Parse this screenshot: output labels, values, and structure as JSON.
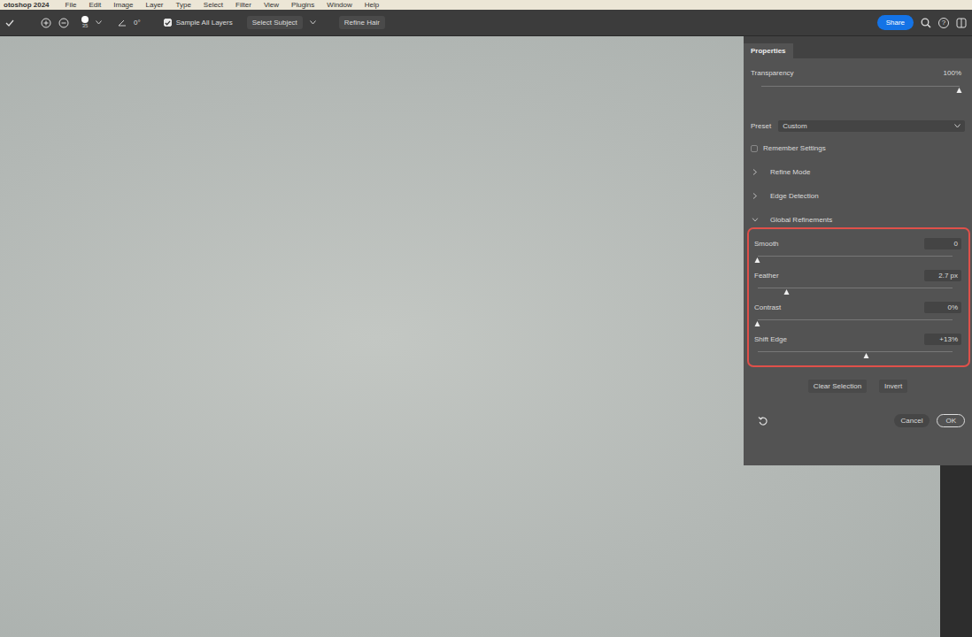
{
  "menu_bar": {
    "app": "otoshop 2024",
    "items": [
      "File",
      "Edit",
      "Image",
      "Layer",
      "Type",
      "Select",
      "Filter",
      "View",
      "Plugins",
      "Window",
      "Help"
    ]
  },
  "options_bar": {
    "brush_size": "35",
    "angle": "0°",
    "sample_all_layers": {
      "label": "Sample All Layers",
      "checked": true
    },
    "select_subject": "Select Subject",
    "refine_hair": "Refine Hair",
    "share": "Share",
    "help": "?"
  },
  "panel": {
    "tab": "Properties",
    "transparency": {
      "label": "Transparency",
      "reading": "100%",
      "level": 1
    },
    "preset": {
      "label": "Preset",
      "value": "Custom"
    },
    "remember_settings": {
      "label": "Remember Settings",
      "checked": false
    },
    "sections": [
      {
        "label": "Refine Mode",
        "expanded": false
      },
      {
        "label": "Edge Detection",
        "expanded": false
      },
      {
        "label": "Global Refinements",
        "expanded": true
      }
    ],
    "sliders": [
      {
        "label": "Smooth",
        "reading": "0",
        "level": 0
      },
      {
        "label": "Feather",
        "reading": "2.7 px",
        "level": 0.15
      },
      {
        "label": "Contrast",
        "reading": "0%",
        "level": 0
      },
      {
        "label": "Shift Edge",
        "reading": "+13%",
        "level": 0.56
      }
    ],
    "buttons": [
      "Clear Selection",
      "Invert"
    ],
    "footer_buttons": [
      {
        "label": "Cancel",
        "primary": false
      },
      {
        "label": "OK",
        "primary": true
      }
    ]
  }
}
